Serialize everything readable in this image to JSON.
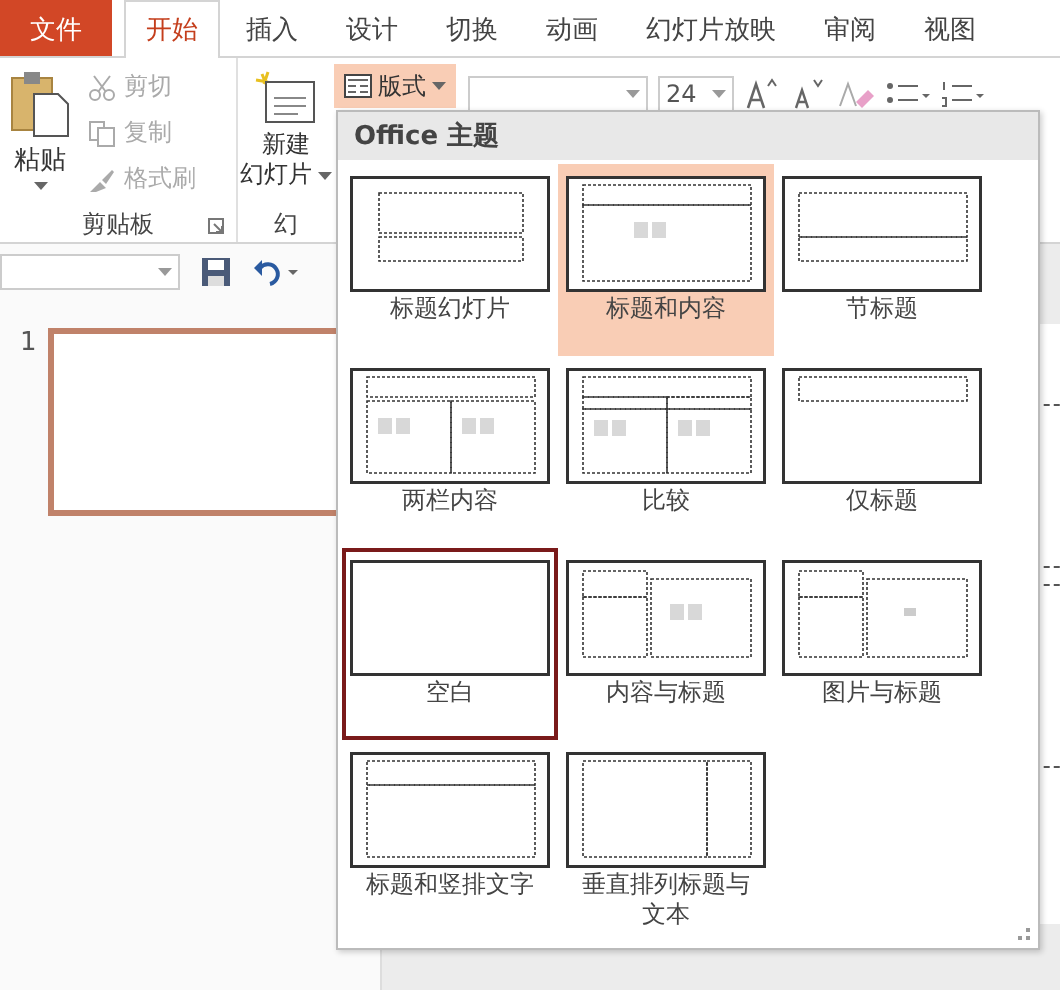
{
  "tabs": [
    {
      "label": "文件",
      "kind": "file",
      "selected": false
    },
    {
      "label": "开始",
      "kind": "tab",
      "selected": true
    },
    {
      "label": "插入",
      "kind": "tab",
      "selected": false
    },
    {
      "label": "设计",
      "kind": "tab",
      "selected": false
    },
    {
      "label": "切换",
      "kind": "tab",
      "selected": false
    },
    {
      "label": "动画",
      "kind": "tab",
      "selected": false
    },
    {
      "label": "幻灯片放映",
      "kind": "tab",
      "selected": false
    },
    {
      "label": "审阅",
      "kind": "tab",
      "selected": false
    },
    {
      "label": "视图",
      "kind": "tab",
      "selected": false
    }
  ],
  "clipboard": {
    "paste": "粘贴",
    "group_label": "剪贴板",
    "commands": [
      {
        "label": "剪切",
        "kind": "cut",
        "disabled": true
      },
      {
        "label": "复制",
        "kind": "copy",
        "disabled": true
      },
      {
        "label": "格式刷",
        "kind": "brush",
        "disabled": true
      }
    ]
  },
  "slides_group": {
    "new_slide": [
      "新建",
      "幻灯片"
    ],
    "layout_button": {
      "label": "版式",
      "open": true
    },
    "group_label": "幻"
  },
  "font": {
    "size": "24"
  },
  "slide_panel": {
    "number": "1"
  },
  "layout_menu": {
    "title": "Office 主题",
    "layouts": [
      {
        "label": "标题幻灯片",
        "kind": "title",
        "selected": false,
        "hovered": false
      },
      {
        "label": "标题和内容",
        "kind": "title-content",
        "selected": false,
        "hovered": true
      },
      {
        "label": "节标题",
        "kind": "section",
        "selected": false,
        "hovered": false
      },
      {
        "label": "两栏内容",
        "kind": "two-content",
        "selected": false,
        "hovered": false
      },
      {
        "label": "比较",
        "kind": "comparison",
        "selected": false,
        "hovered": false
      },
      {
        "label": "仅标题",
        "kind": "title-only",
        "selected": false,
        "hovered": false
      },
      {
        "label": "空白",
        "kind": "blank",
        "selected": true,
        "hovered": false
      },
      {
        "label": "内容与标题",
        "kind": "content-caption",
        "selected": false,
        "hovered": false
      },
      {
        "label": "图片与标题",
        "kind": "picture-caption",
        "selected": false,
        "hovered": false
      },
      {
        "label": "标题和竖排文字",
        "kind": "vertical-text",
        "selected": false,
        "hovered": false
      },
      {
        "label": "垂直排列标题与文本",
        "kind": "vertical-title",
        "selected": false,
        "hovered": false
      }
    ]
  }
}
